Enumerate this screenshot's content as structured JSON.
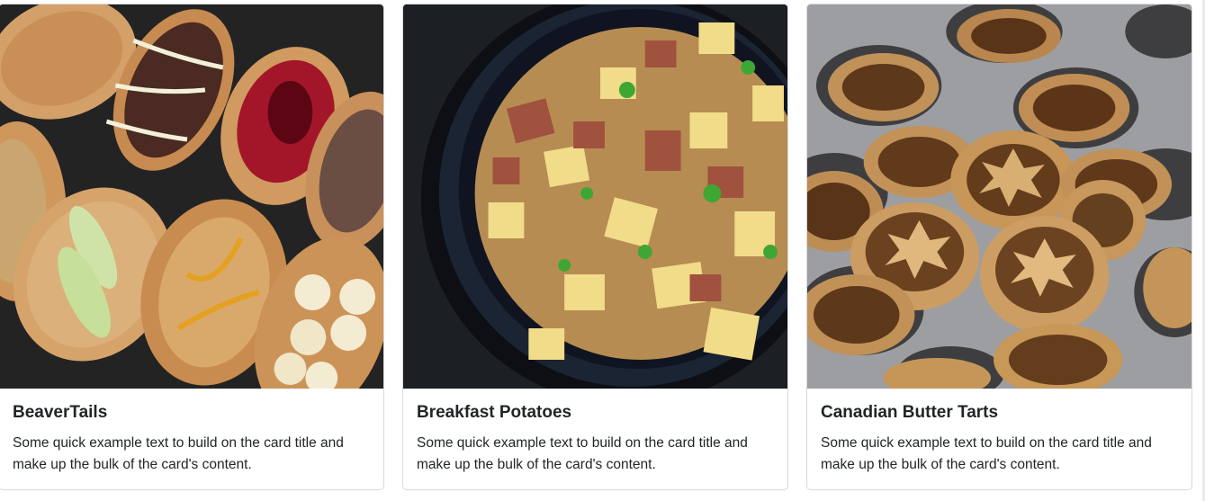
{
  "cards": [
    {
      "title": "BeaverTails",
      "text": "Some quick example text to build on the card title and make up the bulk of the card's content.",
      "image_alt": "BeaverTails pastries"
    },
    {
      "title": "Breakfast Potatoes",
      "text": "Some quick example text to build on the card title and make up the bulk of the card's content.",
      "image_alt": "Breakfast potatoes in skillet"
    },
    {
      "title": "Canadian Butter Tarts",
      "text": "Some quick example text to build on the card title and make up the bulk of the card's content.",
      "image_alt": "Butter tarts in muffin tin"
    }
  ],
  "colors": {
    "card_border": "#d9d9d9",
    "title": "#212529",
    "text": "#212529"
  }
}
